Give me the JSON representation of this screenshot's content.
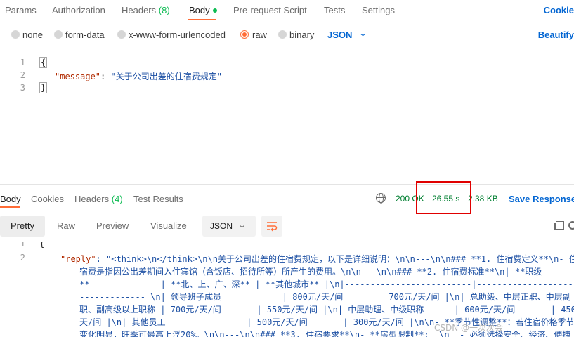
{
  "request_tabs": {
    "params": "Params",
    "authorization": "Authorization",
    "headers": "Headers",
    "headers_count": "(8)",
    "body": "Body",
    "pre_request": "Pre-request Script",
    "tests": "Tests",
    "settings": "Settings",
    "cookies": "Cookie"
  },
  "body_types": {
    "none": "none",
    "form_data": "form-data",
    "urlencoded": "x-www-form-urlencoded",
    "raw": "raw",
    "binary": "binary",
    "selected": "raw",
    "format": "JSON",
    "beautify": "Beautify"
  },
  "request_body": {
    "lines": [
      "1",
      "2",
      "3"
    ],
    "open_brace": "{",
    "key": "\"message\"",
    "colon": ": ",
    "value": "\"关于公司出差的住宿费规定\"",
    "close_brace": "}"
  },
  "response_tabs": {
    "body": "Body",
    "cookies": "Cookies",
    "headers": "Headers",
    "headers_count": "(4)",
    "test_results": "Test Results"
  },
  "response_meta": {
    "status": "200 OK",
    "time": "26.55 s",
    "size": "2.38 KB",
    "save": "Save Response"
  },
  "response_toolbar": {
    "pretty": "Pretty",
    "raw": "Raw",
    "preview": "Preview",
    "visualize": "Visualize",
    "format": "JSON"
  },
  "response_body": {
    "line1": "1",
    "line2": "2",
    "open_brace": "{",
    "key": "\"reply\"",
    "lines": [
      ": \"<think>\\n</think>\\n\\n关于公司出差的住宿费规定，以下是详细说明：\\n\\n---\\n\\n### **1. 住宿费定义**\\n- 住",
      "宿费是指因公出差期间入住宾馆（含饭店、招待所等）所产生的费用。\\n\\n---\\n\\n### **2. 住宿费标准**\\n| **职级",
      "**              | **北、上、广、深** | **其他城市** |\\n|-------------------------|-------------------|",
      "-------------|\\n| 领导班子成员            | 800元/天/间       | 700元/天/间 |\\n| 总助级、中层正职、中层副",
      "职、副高级以上职称 | 700元/天/间       | 550元/天/间 |\\n| 中层助理、中级职称      | 600元/天/间       | 450元/",
      "天/间 |\\n| 其他员工                | 500元/天/间       | 300元/天/间 |\\n\\n- **季节性调整**：若住宿价格季节性",
      "变化明显，旺季可最高上浮20%。\\n\\n---\\n\\n### **3. 住宿要求**\\n- **房型限制**:  \\n  - 必须选择安全、经济、便捷"
    ]
  },
  "watermark": "CSDN @一次次会"
}
